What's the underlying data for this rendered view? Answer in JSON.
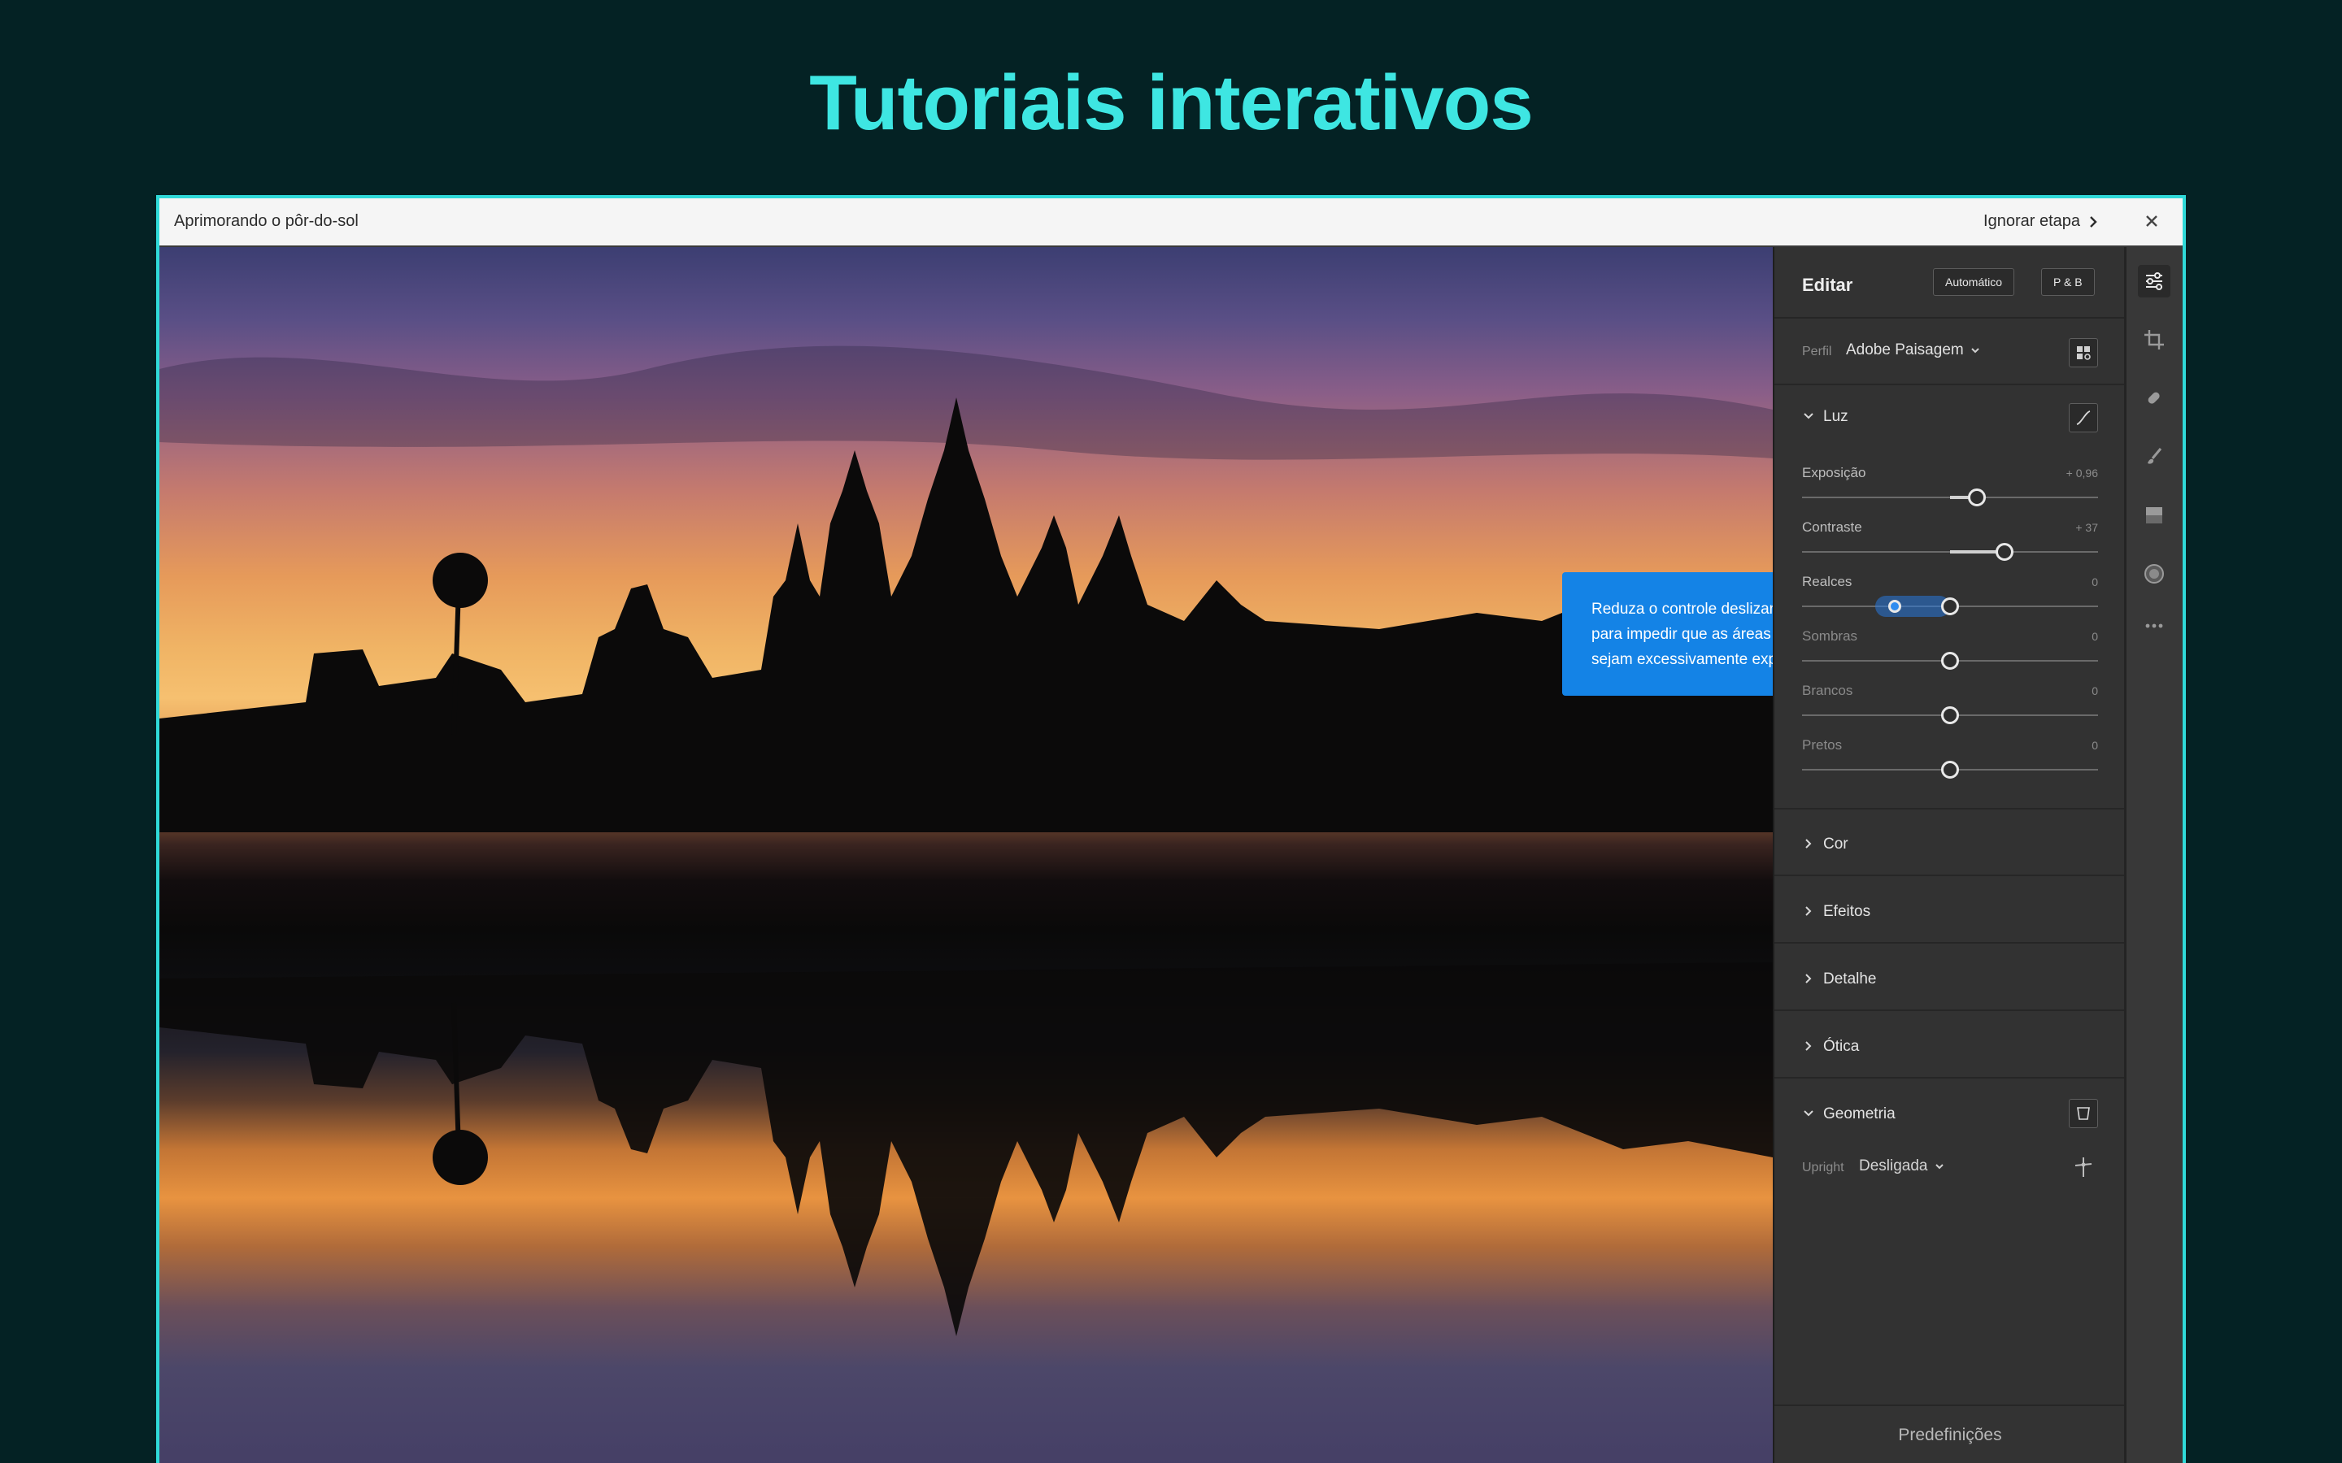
{
  "hero": {
    "title": "Tutoriais interativos"
  },
  "window": {
    "title": "Aprimorando o pôr-do-sol",
    "skip_label": "Ignorar etapa"
  },
  "hint": {
    "text": "Reduza o controle deslizante Realces para impedir que as áreas brilhantes sejam excessivamente expostas."
  },
  "panel": {
    "title": "Editar",
    "auto_label": "Automático",
    "bw_label": "P & B",
    "profile_label": "Perfil",
    "profile_value": "Adobe Paisagem",
    "light": {
      "label": "Luz",
      "sliders": [
        {
          "label": "Exposição",
          "value": "+ 0,96",
          "level": 0.59,
          "active": false
        },
        {
          "label": "Contraste",
          "value": "+ 37",
          "level": 0.685,
          "active": false
        },
        {
          "label": "Realces",
          "value": "0",
          "level": 0.5,
          "active": true
        },
        {
          "label": "Sombras",
          "value": "0",
          "level": 0.5,
          "active": false
        },
        {
          "label": "Brancos",
          "value": "0",
          "level": 0.5,
          "active": false
        },
        {
          "label": "Pretos",
          "value": "0",
          "level": 0.5,
          "active": false
        }
      ]
    },
    "sections": [
      "Cor",
      "Efeitos",
      "Detalhe",
      "Ótica"
    ],
    "geometry": {
      "label": "Geometria",
      "upright_label": "Upright",
      "upright_value": "Desligada"
    },
    "presets_label": "Predefinições"
  },
  "rail_icons": [
    "edit-sliders-icon",
    "crop-icon",
    "healing-icon",
    "brush-icon",
    "linear-gradient-icon",
    "radial-gradient-icon",
    "more-icon"
  ],
  "colors": {
    "accent": "#3ee6e2",
    "hint": "#1483e6",
    "panel": "#323232"
  }
}
